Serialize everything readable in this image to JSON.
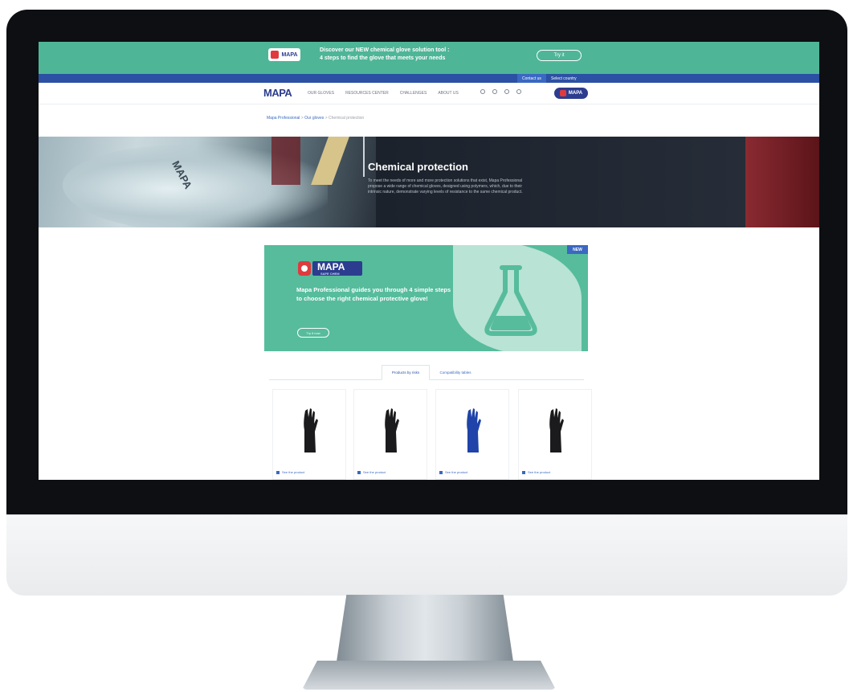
{
  "promo_bar": {
    "logo_text": "MAPA",
    "message_line1": "Discover our NEW chemical glove solution tool :",
    "message_line2": "4 steps to find the glove that meets your needs",
    "button_label": "Try it"
  },
  "utility_bar": {
    "contact_label": "Contact us",
    "country_label": "Select country"
  },
  "nav": {
    "logo": "MAPA",
    "items": [
      "OUR GLOVES",
      "RESOURCES CENTER",
      "CHALLENGES",
      "ABOUT US"
    ],
    "badge_text": "MAPA"
  },
  "breadcrumb": {
    "home": "Mapa Professional",
    "parent": "Our gloves",
    "current": "Chemical protection"
  },
  "hero": {
    "glove_brand": "MAPA",
    "title": "Chemical protection",
    "description": "To meet the needs of more and more protection solutions that exist, Mapa Professional propose a wide range of chemical gloves, designed using polymers, which, due to their intrinsic nature, demonstrate varying levels of resistance to the same chemical product."
  },
  "banner": {
    "new_badge": "NEW",
    "logo_name": "MAPA",
    "logo_sub": "SAFE CHEM",
    "text": "Mapa Professional guides you through 4 simple steps to choose the right chemical protective glove!",
    "button_label": "Try it now"
  },
  "tabs": {
    "active": "Products by risks",
    "inactive": "Compatibility tables"
  },
  "products": [
    {
      "label": "See the product",
      "color": "#1b1b1d"
    },
    {
      "label": "See the product",
      "color": "#1b1b1d"
    },
    {
      "label": "See the product",
      "color": "#1f43a8"
    },
    {
      "label": "See the product",
      "color": "#1b1b1d"
    }
  ],
  "colors": {
    "brand_green": "#4fb597",
    "brand_navy": "#2c3d8f",
    "brand_blue": "#2c50a3",
    "brand_red": "#e03a3e"
  }
}
